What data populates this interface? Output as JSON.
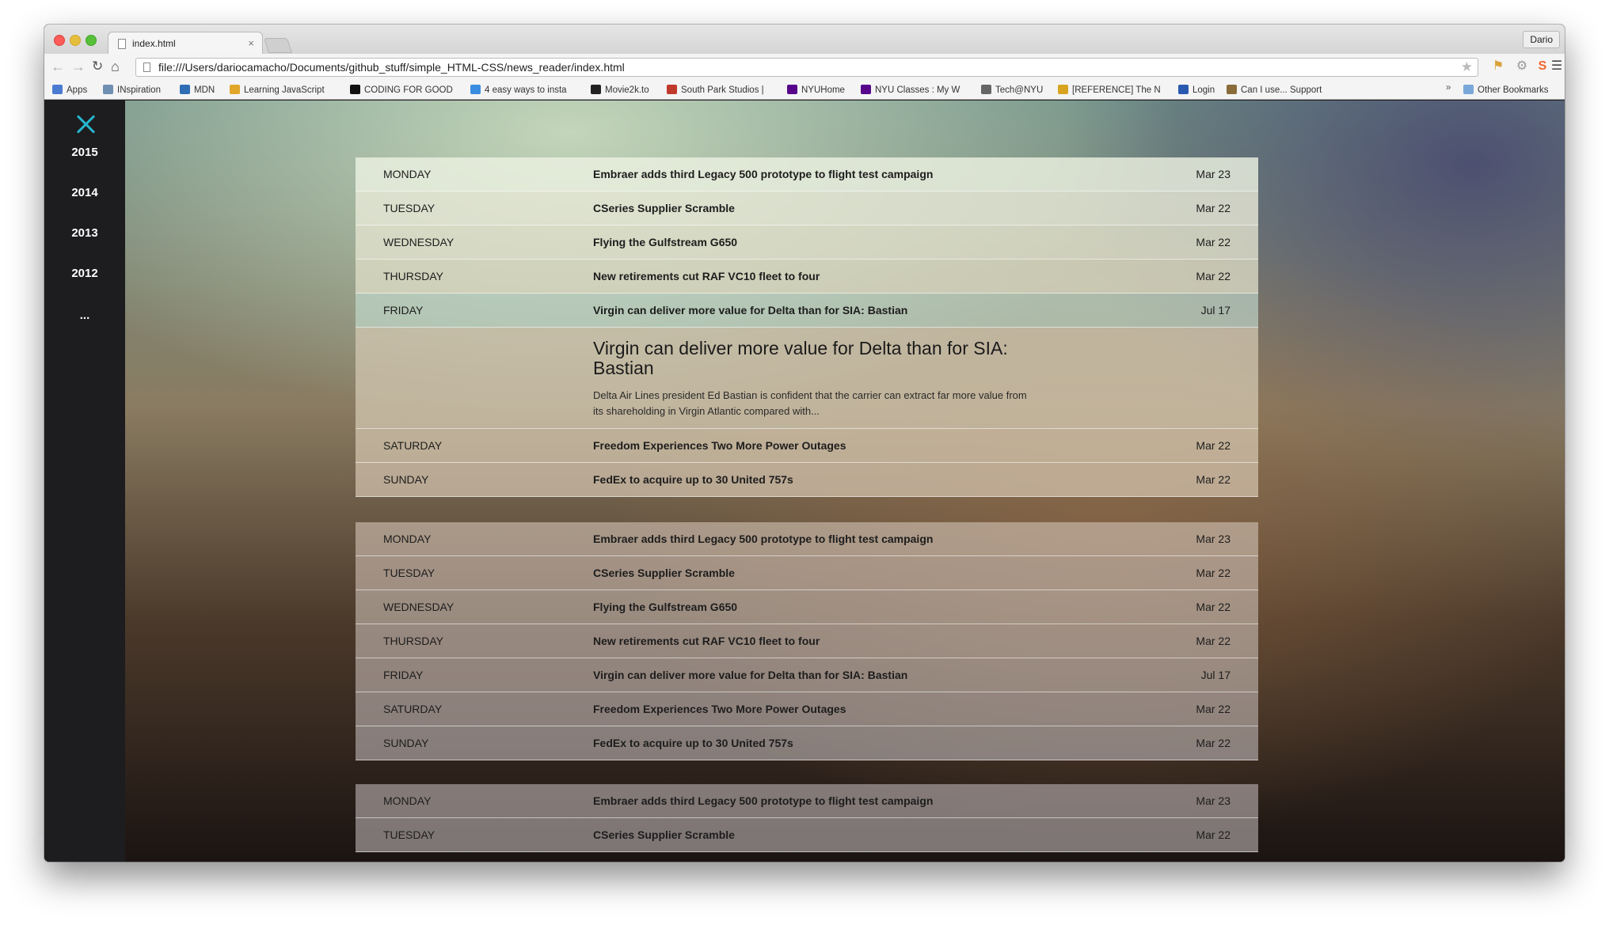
{
  "browser": {
    "tab_title": "index.html",
    "tab_close": "×",
    "profile_name": "Dario",
    "url": "file:///Users/dariocamacho/Documents/github_stuff/simple_HTML-CSS/news_reader/index.html",
    "bookmarks": [
      {
        "label": "Apps",
        "color": "#4a7bd1"
      },
      {
        "label": "INspiration",
        "color": "#6f8fb3"
      },
      {
        "label": "MDN",
        "color": "#2f6eb5"
      },
      {
        "label": "Learning JavaScript",
        "color": "#e0a72b"
      },
      {
        "label": "CODING FOR GOOD",
        "color": "#111111"
      },
      {
        "label": "4 easy ways to insta",
        "color": "#3a8de0"
      },
      {
        "label": "Movie2k.to",
        "color": "#222222"
      },
      {
        "label": "South Park Studios |",
        "color": "#c0392b"
      },
      {
        "label": "NYUHome",
        "color": "#57068c"
      },
      {
        "label": "NYU Classes : My W",
        "color": "#57068c"
      },
      {
        "label": "Tech@NYU",
        "color": "#666666"
      },
      {
        "label": "[REFERENCE] The N",
        "color": "#d8a420"
      },
      {
        "label": "Login",
        "color": "#2a5ab0"
      },
      {
        "label": "Can I use... Support",
        "color": "#8a6b3a"
      }
    ],
    "bookmarks_more": "»",
    "other_bookmarks": "Other Bookmarks"
  },
  "sidebar": {
    "years": [
      "2015",
      "2014",
      "2013",
      "2012",
      "..."
    ],
    "accent_color": "#27b6cf"
  },
  "weeks": [
    {
      "rows": [
        {
          "day": "MONDAY",
          "title": "Embraer adds third Legacy 500 prototype to flight test campaign",
          "date": "Mar 23"
        },
        {
          "day": "TUESDAY",
          "title": "CSeries Supplier Scramble",
          "date": "Mar 22"
        },
        {
          "day": "WEDNESDAY",
          "title": "Flying the Gulfstream G650",
          "date": "Mar 22"
        },
        {
          "day": "THURSDAY",
          "title": "New retirements cut RAF VC10 fleet to four",
          "date": "Mar 22"
        },
        {
          "day": "FRIDAY",
          "title": "Virgin can deliver more value for Delta than for SIA: Bastian",
          "date": "Jul 17"
        },
        {
          "day": "SATURDAY",
          "title": "Freedom Experiences Two More Power Outages",
          "date": "Mar 22"
        },
        {
          "day": "SUNDAY",
          "title": "FedEx to acquire up to 30 United 757s",
          "date": "Mar 22"
        }
      ],
      "expanded": {
        "headline": "Virgin can deliver more value for Delta than for SIA: Bastian",
        "summary": "Delta Air Lines president Ed Bastian is confident that the carrier can extract far more value from its shareholding in Virgin Atlantic compared with..."
      }
    },
    {
      "rows": [
        {
          "day": "MONDAY",
          "title": "Embraer adds third Legacy 500 prototype to flight test campaign",
          "date": "Mar 23"
        },
        {
          "day": "TUESDAY",
          "title": "CSeries Supplier Scramble",
          "date": "Mar 22"
        },
        {
          "day": "WEDNESDAY",
          "title": "Flying the Gulfstream G650",
          "date": "Mar 22"
        },
        {
          "day": "THURSDAY",
          "title": "New retirements cut RAF VC10 fleet to four",
          "date": "Mar 22"
        },
        {
          "day": "FRIDAY",
          "title": "Virgin can deliver more value for Delta than for SIA: Bastian",
          "date": "Jul 17"
        },
        {
          "day": "SATURDAY",
          "title": "Freedom Experiences Two More Power Outages",
          "date": "Mar 22"
        },
        {
          "day": "SUNDAY",
          "title": "FedEx to acquire up to 30 United 757s",
          "date": "Mar 22"
        }
      ]
    },
    {
      "rows": [
        {
          "day": "MONDAY",
          "title": "Embraer adds third Legacy 500 prototype to flight test campaign",
          "date": "Mar 23"
        },
        {
          "day": "TUESDAY",
          "title": "CSeries Supplier Scramble",
          "date": "Mar 22"
        }
      ]
    }
  ]
}
